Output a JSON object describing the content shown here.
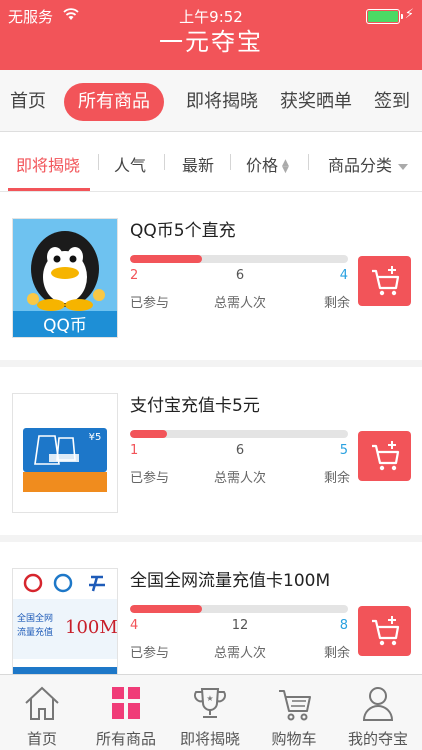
{
  "status_bar": {
    "carrier": "无服务",
    "time": "上午9:52"
  },
  "header": {
    "title": "一元夺宝"
  },
  "nav": {
    "tabs": [
      {
        "label": "首页",
        "active": false
      },
      {
        "label": "所有商品",
        "active": true
      },
      {
        "label": "即将揭晓",
        "active": false
      },
      {
        "label": "获奖晒单",
        "active": false
      },
      {
        "label": "签到",
        "active": false
      }
    ]
  },
  "filter": {
    "items": [
      {
        "label": "即将揭晓",
        "active": true
      },
      {
        "label": "人气"
      },
      {
        "label": "最新"
      },
      {
        "label": "价格",
        "icon": "sort-arrows-icon"
      },
      {
        "label": "商品分类",
        "icon": "caret-down-icon"
      }
    ]
  },
  "labels": {
    "joined": "已参与",
    "total": "总需人次",
    "remaining": "剩余"
  },
  "products": [
    {
      "name": "QQ币5个直充",
      "joined": "2",
      "total": "6",
      "remaining": "4",
      "progress": 0.33,
      "image": "qq-coin-card",
      "image_text": "QQ币"
    },
    {
      "name": "支付宝充值卡5元",
      "joined": "1",
      "total": "6",
      "remaining": "5",
      "progress": 0.17,
      "image": "alipay-card",
      "image_text": "¥5"
    },
    {
      "name": "全国全网流量充值卡100M",
      "joined": "4",
      "total": "12",
      "remaining": "8",
      "progress": 0.33,
      "image": "data-card",
      "image_text": "全国全网流量充值 100M"
    }
  ],
  "tabbar": {
    "items": [
      {
        "label": "首页",
        "icon": "home-icon"
      },
      {
        "label": "所有商品",
        "icon": "grid-icon",
        "active": true
      },
      {
        "label": "即将揭晓",
        "icon": "trophy-icon"
      },
      {
        "label": "购物车",
        "icon": "cart-icon"
      },
      {
        "label": "我的夺宝",
        "icon": "user-icon"
      }
    ]
  },
  "colors": {
    "accent": "#f25459",
    "remaining": "#2aa1e0",
    "battery": "#4cd964"
  }
}
